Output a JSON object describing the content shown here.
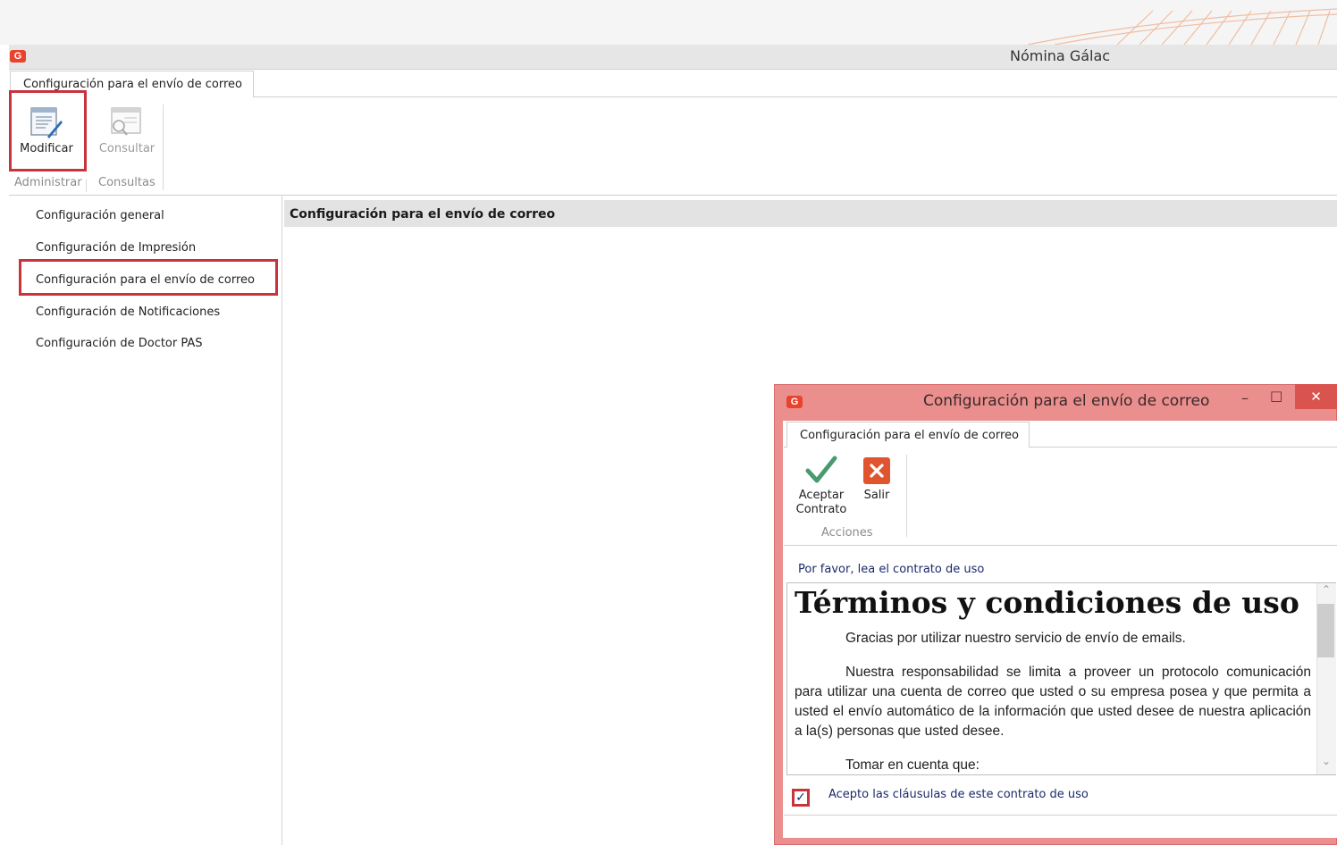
{
  "window": {
    "title": "Nómina Gálac",
    "logo_letter": "G"
  },
  "ribbon": {
    "tab_label": "Configuración para el envío de correo",
    "buttons": {
      "modify": "Modificar",
      "consult": "Consultar"
    },
    "groups": {
      "admin": "Administrar",
      "consults": "Consultas"
    }
  },
  "sidebar": {
    "items": [
      {
        "label": "Configuración general"
      },
      {
        "label": "Configuración de Impresión"
      },
      {
        "label": "Configuración para el envío de correo"
      },
      {
        "label": "Configuración de Notificaciones"
      },
      {
        "label": "Configuración de Doctor PAS"
      }
    ]
  },
  "main": {
    "header": "Configuración para el envío de correo"
  },
  "dialog": {
    "title": "Configuración para el envío de correo",
    "logo_letter": "G",
    "controls": {
      "minimize": "–",
      "maximize": "□",
      "close": "✕"
    },
    "tab_label": "Configuración para el envío de correo",
    "buttons": {
      "accept_line1": "Aceptar",
      "accept_line2": "Contrato",
      "exit": "Salir"
    },
    "group_label": "Acciones",
    "prompt": "Por favor, lea el contrato de uso",
    "contract": {
      "heading": "Términos y condiciones de uso",
      "p1": "Gracias por utilizar nuestro servicio de envío de emails.",
      "p2": "Nuestra responsabilidad se limita a proveer un protocolo comunicación para utilizar una cuenta de correo que usted o su empresa posea y que permita a usted el envío automático de la información que usted desee de nuestra aplicación a la(s) personas que usted desee.",
      "p3": "Tomar en cuenta que:"
    },
    "scroll": {
      "up": "⌃",
      "down": "⌄"
    },
    "checkbox": {
      "checked": true,
      "mark": "✓",
      "label": "Acepto las cláusulas de este contrato de uso"
    }
  },
  "colors": {
    "highlight_red": "#c8333c",
    "dialog_frame": "#ea8e8e",
    "link_blue": "#1b2a6b",
    "accept_green": "#4a9a6f",
    "exit_orange": "#e0552f"
  }
}
